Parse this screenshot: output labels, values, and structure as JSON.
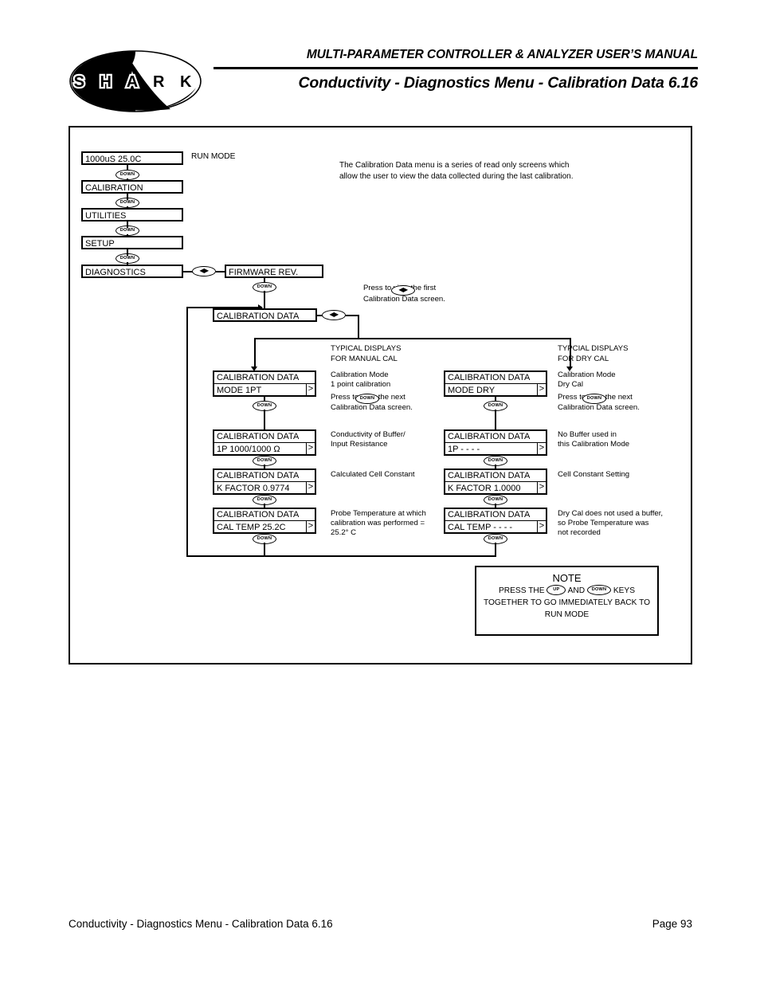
{
  "header": {
    "logo_text": "S H A R K",
    "title_line1": "MULTI-PARAMETER CONTROLLER & ANALYZER USER’S MANUAL",
    "title_line2": "Conductivity - Diagnostics Menu - Calibration Data 6.16"
  },
  "footer": {
    "left": "Conductivity - Diagnostics Menu - Calibration Data 6.16",
    "right": "Page 93"
  },
  "keys": {
    "down": "DOWN",
    "up": "UP",
    "leftright": "◀▶"
  },
  "intro": {
    "text": "The Calibration Data menu is a series of read only screens which\nallow the user to view the data collected during the last calibration."
  },
  "main_menu": {
    "run_mode_label": "RUN MODE",
    "items": [
      {
        "label": "1000uS  25.0C"
      },
      {
        "label": "CALIBRATION"
      },
      {
        "label": "UTILITIES"
      },
      {
        "label": "SETUP"
      },
      {
        "label": "DIAGNOSTICS"
      }
    ]
  },
  "diagnostics_branch": {
    "firmware_rev": "FIRMWARE REV.",
    "calibration_data": "CALIBRATION DATA",
    "press_note": "Press           to view the first\nCalibration Data screen."
  },
  "manual_cal": {
    "caption": "TYPICAL DISPLAYS\nFOR MANUAL CAL",
    "screens": [
      {
        "row1": "CALIBRATION DATA",
        "row2": "MODE  1PT",
        "arrow": ">",
        "annotation": "Calibration Mode\n1 point calibration"
      },
      {
        "row1": "CALIBRATION DATA",
        "row2": "1P 1000/1000 Ω",
        "arrow": ">",
        "annotation": "Conductivity of Buffer/\nInput Resistance"
      },
      {
        "row1": "CALIBRATION DATA",
        "row2": "K FACTOR 0.9774",
        "arrow": ">",
        "annotation": "Calculated Cell Constant"
      },
      {
        "row1": "CALIBRATION DATA",
        "row2": "CAL TEMP 25.2C",
        "arrow": ">",
        "annotation": "Probe Temperature at which\ncalibration was performed =\n25.2° C"
      }
    ],
    "press_note": "Press             to view the next\nCalibration Data screen."
  },
  "dry_cal": {
    "caption": "TYPCIAL DISPLAYS\nFOR DRY CAL",
    "screens": [
      {
        "row1": "CALIBRATION DATA",
        "row2": "MODE DRY",
        "arrow": ">",
        "annotation": "Calibration Mode\nDry Cal"
      },
      {
        "row1": "CALIBRATION DATA",
        "row2": "1P - - - -",
        "arrow": ">",
        "annotation": "No Buffer used in\nthis Calibration Mode"
      },
      {
        "row1": "CALIBRATION DATA",
        "row2": "K FACTOR 1.0000",
        "arrow": ">",
        "annotation": "Cell Constant Setting"
      },
      {
        "row1": "CALIBRATION DATA",
        "row2": "CAL TEMP - - - -",
        "arrow": ">",
        "annotation": "Dry Cal does not used a buffer,\nso Probe Temperature was\nnot recorded"
      }
    ],
    "press_note": "Press             to view the next\nCalibration Data screen."
  },
  "note_box": {
    "title": "NOTE",
    "line1_pre": "PRESS THE",
    "line1_mid": "AND",
    "line1_post": "KEYS",
    "line2": "TOGETHER TO GO IMMEDIATELY BACK TO",
    "line3": "RUN MODE"
  },
  "colors": {
    "ink": "#000000",
    "paper": "#ffffff"
  }
}
